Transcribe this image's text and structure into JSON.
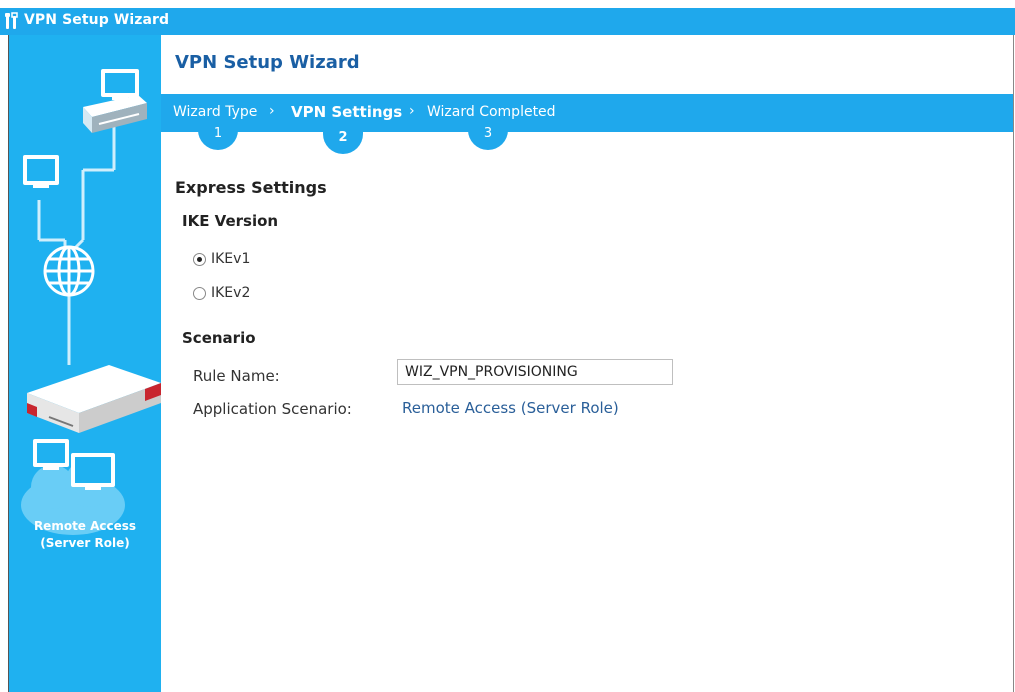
{
  "window": {
    "title": "VPN Setup Wizard"
  },
  "sidebar": {
    "caption_line1": "Remote Access",
    "caption_line2": "(Server Role)"
  },
  "main": {
    "title": "VPN Setup Wizard",
    "steps": [
      {
        "label": "Wizard Type",
        "number": "1",
        "active": false
      },
      {
        "label": "VPN Settings",
        "number": "2",
        "active": true
      },
      {
        "label": "Wizard Completed",
        "number": "3",
        "active": false
      }
    ],
    "express_heading": "Express Settings",
    "ike": {
      "heading": "IKE Version",
      "options": [
        {
          "label": "IKEv1",
          "checked": true
        },
        {
          "label": "IKEv2",
          "checked": false
        }
      ]
    },
    "scenario": {
      "heading": "Scenario",
      "rule_name_label": "Rule Name:",
      "rule_name_value": "WIZ_VPN_PROVISIONING",
      "app_scenario_label": "Application Scenario:",
      "app_scenario_value": "Remote Access (Server Role)"
    }
  },
  "colors": {
    "accent": "#1fa8ec",
    "sidebar": "#1fb1f0",
    "title": "#1a5fa4",
    "link": "#2a5f99"
  }
}
